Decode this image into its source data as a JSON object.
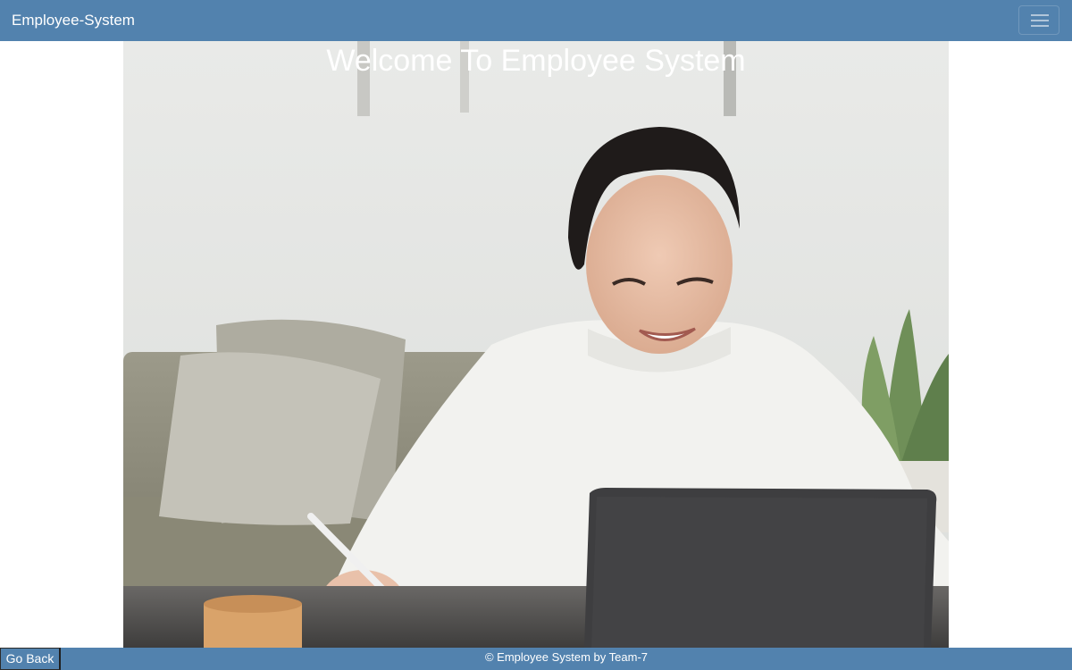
{
  "navbar": {
    "brand": "Employee-System",
    "menu_icon": "hamburger-menu-icon",
    "background_color": "#5282ae"
  },
  "hero": {
    "title": "Welcome To Employee System",
    "image_description_icon": "woman-at-laptop-photo"
  },
  "footer": {
    "copyright": "© Employee System by Team-7",
    "go_back_label": "Go Back",
    "background_color": "#5282ae"
  }
}
